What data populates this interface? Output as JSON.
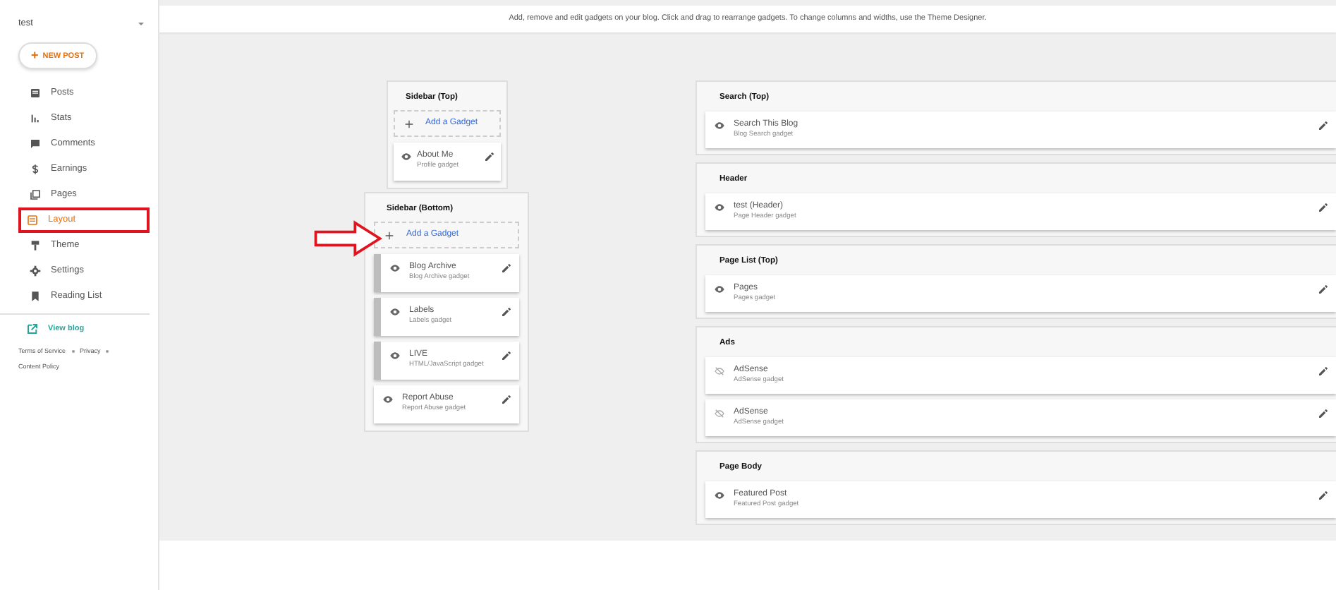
{
  "blog_selector": {
    "title": "test"
  },
  "new_post_button": {
    "icon": "+",
    "label": "NEW POST"
  },
  "nav": [
    {
      "label": "Posts",
      "kind": "posts",
      "selected": false,
      "highlighted": false
    },
    {
      "label": "Stats",
      "kind": "stats",
      "selected": false,
      "highlighted": false
    },
    {
      "label": "Comments",
      "kind": "comments",
      "selected": false,
      "highlighted": false
    },
    {
      "label": "Earnings",
      "kind": "earnings",
      "selected": false,
      "highlighted": false
    },
    {
      "label": "Pages",
      "kind": "pages",
      "selected": false,
      "highlighted": false
    },
    {
      "label": "Layout",
      "kind": "layout",
      "selected": true,
      "highlighted": true
    },
    {
      "label": "Theme",
      "kind": "theme",
      "selected": false,
      "highlighted": false
    },
    {
      "label": "Settings",
      "kind": "settings",
      "selected": false,
      "highlighted": false
    },
    {
      "label": "Reading List",
      "kind": "reading",
      "selected": false,
      "highlighted": false
    }
  ],
  "view_blog": "View blog",
  "footer_links": [
    "Terms of Service",
    "Privacy",
    "Content Policy"
  ],
  "info_bar": {
    "text": "Add, remove and edit gadgets on your blog. Click and drag to rearrange gadgets. To change columns and widths, use the ",
    "link": "Theme Designer",
    "end": "."
  },
  "columns": [
    {
      "sections": [
        {
          "title": "Sidebar (Top)",
          "add_gadget": "Add a Gadget",
          "gadgets": [
            {
              "title": "About Me",
              "subtitle": "Profile gadget",
              "visible": true,
              "movable": false
            }
          ]
        },
        {
          "title": "Sidebar (Bottom)",
          "add_gadget": "Add a Gadget",
          "gadgets": [
            {
              "title": "Blog Archive",
              "subtitle": "Blog Archive gadget",
              "visible": true,
              "movable": true
            },
            {
              "title": "Labels",
              "subtitle": "Labels gadget",
              "visible": true,
              "movable": true
            },
            {
              "title": "LIVE",
              "subtitle": "HTML/JavaScript gadget",
              "visible": true,
              "movable": true
            },
            {
              "title": "Report Abuse",
              "subtitle": "Report Abuse gadget",
              "visible": true,
              "movable": false
            }
          ]
        }
      ]
    },
    {
      "sections": [
        {
          "title": "Search (Top)",
          "gadgets": [
            {
              "title": "Search This Blog",
              "subtitle": "Blog Search gadget",
              "visible": true,
              "movable": false
            }
          ]
        },
        {
          "title": "Header",
          "gadgets": [
            {
              "title": "test (Header)",
              "subtitle": "Page Header gadget",
              "visible": true,
              "movable": false
            }
          ]
        },
        {
          "title": "Page List (Top)",
          "gadgets": [
            {
              "title": "Pages",
              "subtitle": "Pages gadget",
              "visible": true,
              "movable": false
            }
          ]
        },
        {
          "title": "Ads",
          "gadgets": [
            {
              "title": "AdSense",
              "subtitle": "AdSense gadget",
              "visible": false,
              "movable": false
            },
            {
              "title": "AdSense",
              "subtitle": "AdSense gadget",
              "visible": false,
              "movable": false
            }
          ]
        },
        {
          "title": "Page Body",
          "gadgets": [
            {
              "title": "Featured Post",
              "subtitle": "Featured Post gadget",
              "visible": true,
              "movable": false
            }
          ]
        }
      ]
    }
  ]
}
